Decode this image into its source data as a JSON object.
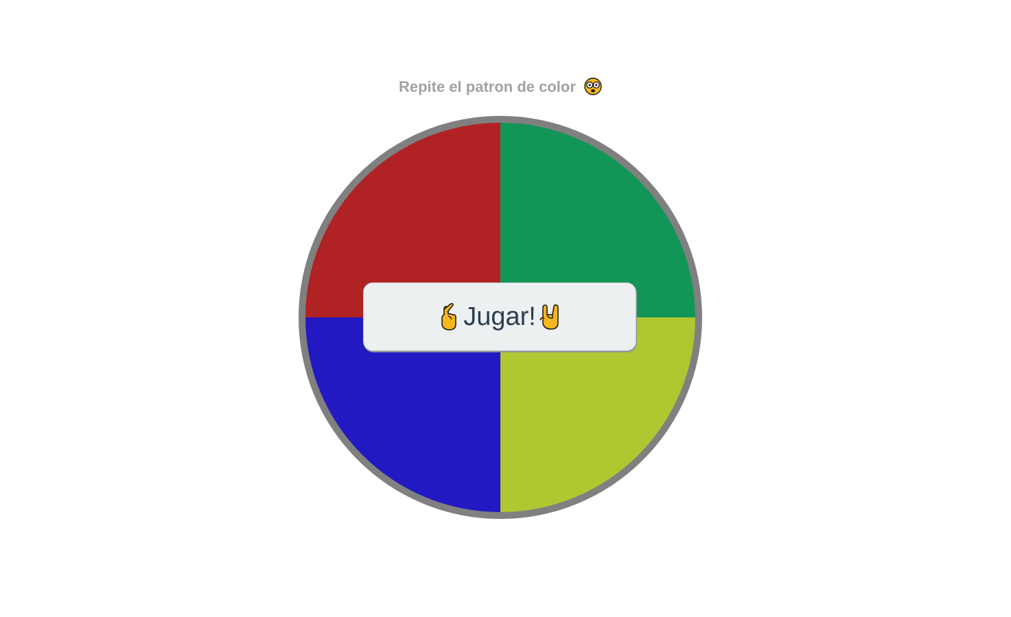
{
  "header": {
    "title": "Repite el patron de color",
    "title_emoji": "face-with-glasses-icon"
  },
  "board": {
    "quadrants": [
      {
        "name": "red-quadrant",
        "color": "#b12224"
      },
      {
        "name": "green-quadrant",
        "color": "#129657"
      },
      {
        "name": "blue-quadrant",
        "color": "#2319c2"
      },
      {
        "name": "yellow-quadrant",
        "color": "#b0c731"
      }
    ],
    "rim_color": "#808080"
  },
  "play_button": {
    "label": "Jugar!",
    "left_icon": "crossed-fingers-icon",
    "right_icon": "rock-on-hand-icon"
  }
}
